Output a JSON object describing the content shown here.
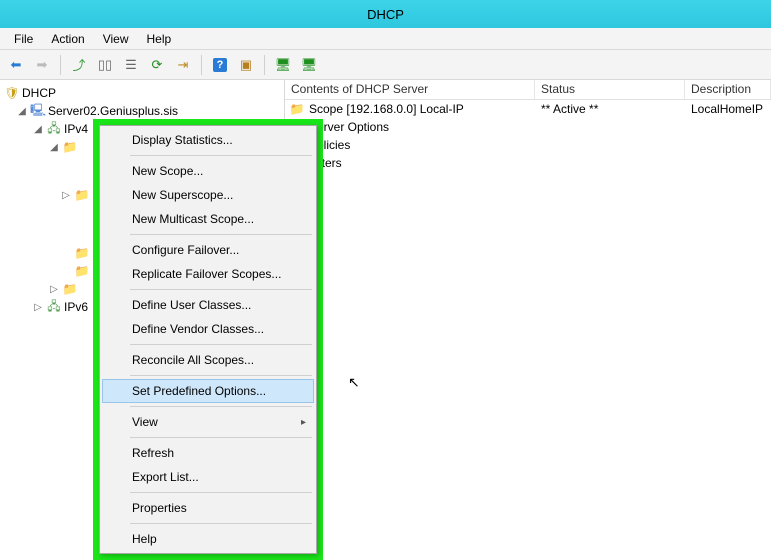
{
  "window": {
    "title": "DHCP"
  },
  "menu": {
    "file": "File",
    "action": "Action",
    "view": "View",
    "help": "Help"
  },
  "tree": {
    "root": "DHCP",
    "server": "Server02.Geniusplus.sis",
    "ipv4": "IPv4",
    "ipv6": "IPv6"
  },
  "columns": {
    "c1": "Contents of DHCP Server",
    "c2": "Status",
    "c3": "Description"
  },
  "rows": [
    {
      "name": "Scope [192.168.0.0] Local-IP",
      "status": "** Active **",
      "desc": "LocalHomeIP"
    },
    {
      "name": "Server Options",
      "status": "",
      "desc": ""
    },
    {
      "name": "Policies",
      "status": "",
      "desc": ""
    },
    {
      "name": "Filters",
      "status": "",
      "desc": ""
    }
  ],
  "context": {
    "display_stats": "Display Statistics...",
    "new_scope": "New Scope...",
    "new_superscope": "New Superscope...",
    "new_multicast": "New Multicast Scope...",
    "config_failover": "Configure Failover...",
    "replicate_failover": "Replicate Failover Scopes...",
    "define_user": "Define User Classes...",
    "define_vendor": "Define Vendor Classes...",
    "reconcile": "Reconcile All Scopes...",
    "set_predefined": "Set Predefined Options...",
    "view": "View",
    "refresh": "Refresh",
    "export": "Export List...",
    "properties": "Properties",
    "help": "Help"
  }
}
